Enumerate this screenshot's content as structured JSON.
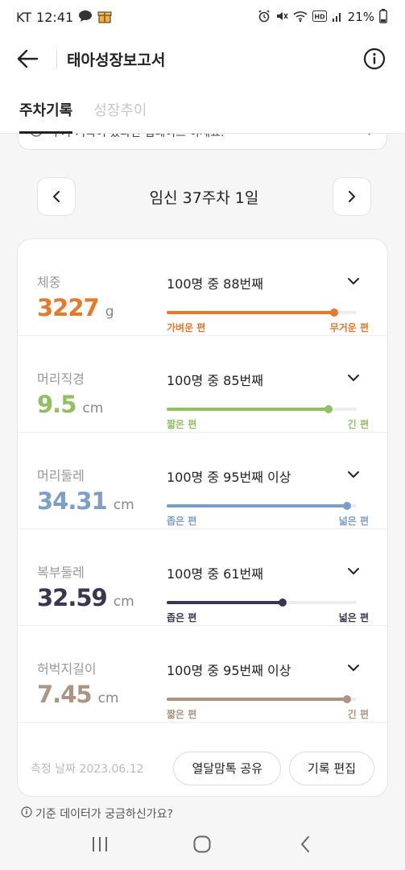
{
  "status": {
    "carrier": "KT",
    "time": "12:41",
    "battery": "21%"
  },
  "header": {
    "title": "태아성장보고서"
  },
  "tabs": [
    {
      "label": "주차기록",
      "active": true
    },
    {
      "label": "성장추이",
      "active": false
    }
  ],
  "notice": {
    "text": "추가 기록이 있다면 업데이트 하세요."
  },
  "week": {
    "label": "임신 37주차 1일"
  },
  "metrics": [
    {
      "name": "체중",
      "value": "3227",
      "unit": "g",
      "rank": "100명 중 88번째",
      "percentile": 88,
      "color": "#e8782a",
      "low_label": "가벼운 편",
      "high_label": "무거운 편"
    },
    {
      "name": "머리직경",
      "value": "9.5",
      "unit": "cm",
      "rank": "100명 중 85번째",
      "percentile": 85,
      "color": "#8fc160",
      "low_label": "짧은 편",
      "high_label": "긴 편"
    },
    {
      "name": "머리둘레",
      "value": "34.31",
      "unit": "cm",
      "rank": "100명 중 95번째 이상",
      "percentile": 95,
      "color": "#7b9fc8",
      "low_label": "좁은 편",
      "high_label": "넓은 편"
    },
    {
      "name": "복부둘레",
      "value": "32.59",
      "unit": "cm",
      "rank": "100명 중 61번째",
      "percentile": 61,
      "color": "#3a3550",
      "low_label": "좁은 편",
      "high_label": "넓은 편"
    },
    {
      "name": "허벅지길이",
      "value": "7.45",
      "unit": "cm",
      "rank": "100명 중 95번째 이상",
      "percentile": 95,
      "color": "#ad9480",
      "low_label": "짧은 편",
      "high_label": "긴 편"
    }
  ],
  "footer": {
    "date": "측정 날짜 2023.06.12",
    "share_label": "열달맘톡 공유",
    "edit_label": "기록 편집"
  },
  "hint": {
    "text": "기준 데이터가 궁금하신가요?"
  }
}
